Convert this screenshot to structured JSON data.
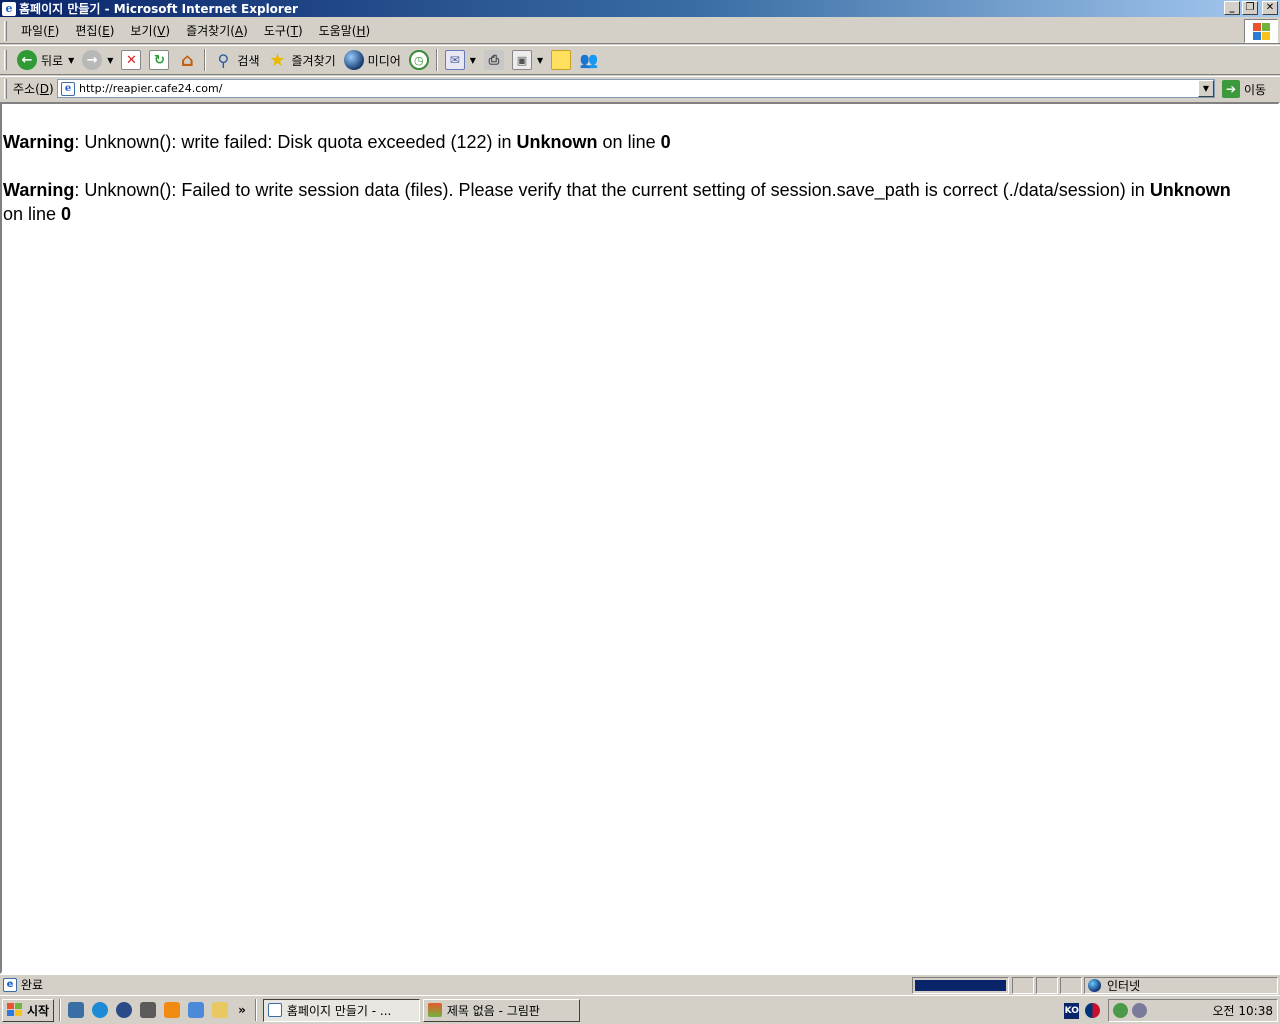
{
  "window": {
    "title": "홈페이지 만들기 - Microsoft Internet Explorer",
    "minimize": "_",
    "restore": "❐",
    "close": "✕"
  },
  "menu": {
    "items": [
      {
        "label": "파일(",
        "accel": "F",
        "end": ")"
      },
      {
        "label": "편집(",
        "accel": "E",
        "end": ")"
      },
      {
        "label": "보기(",
        "accel": "V",
        "end": ")"
      },
      {
        "label": "즐겨찾기(",
        "accel": "A",
        "end": ")"
      },
      {
        "label": "도구(",
        "accel": "T",
        "end": ")"
      },
      {
        "label": "도움말(",
        "accel": "H",
        "end": ")"
      }
    ]
  },
  "toolbar": {
    "back_label": "뒤로",
    "search_label": "검색",
    "favorites_label": "즐겨찾기",
    "media_label": "미디어"
  },
  "address": {
    "label": "주소(",
    "accel": "D",
    "end": ")",
    "url": "http://reapier.cafe24.com/",
    "go_label": "이동"
  },
  "content": {
    "w1_label": "Warning",
    "w1_text": ": Unknown(): write failed: Disk quota exceeded (122) in ",
    "w1_file": "Unknown",
    "w1_online": " on line ",
    "w1_line": "0",
    "w2_label": "Warning",
    "w2_text": ": Unknown(): Failed to write session data (files). Please verify that the current setting of session.save_path is correct (./data/session) in ",
    "w2_file": "Unknown",
    "w2_online": " on line ",
    "w2_line": "0"
  },
  "status": {
    "text": "완료",
    "zone": "인터넷",
    "progress": 1.0
  },
  "taskbar": {
    "start_label": "시작",
    "tasks": [
      {
        "label": "홈페이지 만들기 - ..."
      },
      {
        "label": "제목 없음 - 그림판"
      }
    ],
    "ime": "KO",
    "clock": "오전 10:38",
    "overflow": "»"
  },
  "colors": {
    "titlebar_start": "#0a246a",
    "chrome": "#d4d0c8",
    "content_bg": "#ffffff"
  }
}
